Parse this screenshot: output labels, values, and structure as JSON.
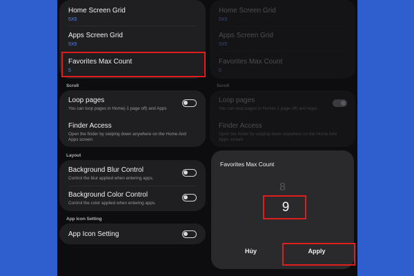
{
  "settings": {
    "home_grid": {
      "title": "Home Screen Grid",
      "value": "5X5"
    },
    "apps_grid": {
      "title": "Apps Screen Grid",
      "value": "5X5"
    },
    "favorites": {
      "title": "Favorites Max Count",
      "value": "5"
    },
    "scroll_section": "Scroll",
    "loop_pages": {
      "title": "Loop pages",
      "subtitle": "You can loop pages in Home(-1 page off) and Apps",
      "enabled": false
    },
    "finder_access": {
      "title": "Finder Access",
      "subtitle_line1": "Open the finder by swiping down anywhere on the Home And",
      "subtitle_line2": "Apps screen"
    },
    "layout_section": "Layout",
    "bg_blur": {
      "title": "Background Blur Control",
      "subtitle": "Control the blur applied when entering apps.",
      "enabled": false
    },
    "bg_color": {
      "title": "Background Color Control",
      "subtitle": "Control the color applied when entering apps.",
      "enabled": false
    },
    "app_icon_section": "App Icon Setting",
    "app_icon": {
      "title": "App Icon Setting",
      "enabled": false
    }
  },
  "dialog": {
    "title": "Favorites Max Count",
    "previous_value": "8",
    "selected_value": "9",
    "cancel_label": "Hủy",
    "apply_label": "Apply"
  },
  "colors": {
    "accent_value": "#5e86e8",
    "highlight": "#e01e1e",
    "background": "#2f5fcf"
  },
  "icons": [
    "toggle-switch-icon"
  ]
}
